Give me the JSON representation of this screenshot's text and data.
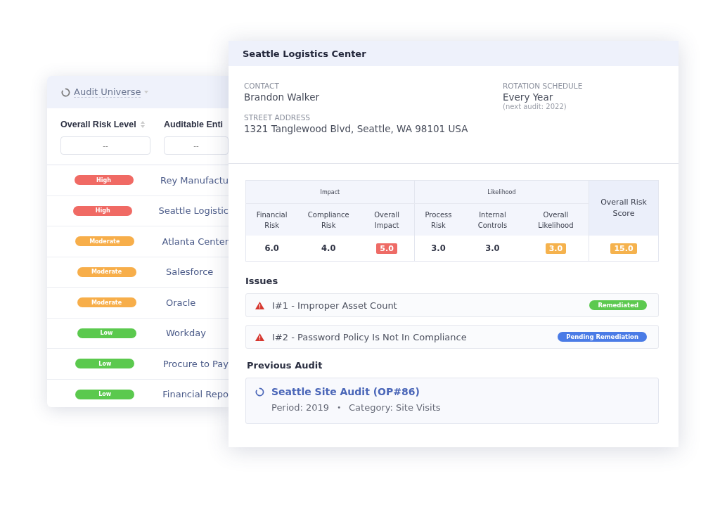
{
  "audit_universe": {
    "title": "Audit Universe",
    "columns": [
      {
        "label": "Overall Risk Level",
        "filter_placeholder": "--"
      },
      {
        "label": "Auditable Enti",
        "filter_placeholder": "--"
      }
    ],
    "rows": [
      {
        "risk": "High",
        "color": "#f06a64",
        "entity": "Rey Manufactu"
      },
      {
        "risk": "High",
        "color": "#f06a64",
        "entity": "Seattle Logistic"
      },
      {
        "risk": "Moderate",
        "color": "#f7ae4a",
        "entity": "Atlanta Center"
      },
      {
        "risk": "Moderate",
        "color": "#f7ae4a",
        "entity": "Salesforce"
      },
      {
        "risk": "Moderate",
        "color": "#f7ae4a",
        "entity": "Oracle"
      },
      {
        "risk": "Low",
        "color": "#5bc94e",
        "entity": "Workday"
      },
      {
        "risk": "Low",
        "color": "#5bc94e",
        "entity": "Procure to Pay"
      },
      {
        "risk": "Low",
        "color": "#5bc94e",
        "entity": "Financial Repo"
      }
    ]
  },
  "detail": {
    "title": "Seattle Logistics Center",
    "contact": {
      "label": "CONTACT",
      "value": "Brandon Walker"
    },
    "address": {
      "label": "STREET ADDRESS",
      "value": "1321 Tanglewood Blvd, Seattle, WA 98101 USA"
    },
    "rotation": {
      "label": "ROTATION SCHEDULE",
      "value": "Every Year",
      "note": "(next audit: 2022)"
    },
    "risk_table": {
      "groups": [
        {
          "label": "Impact",
          "columns": [
            {
              "label": "Financial Risk",
              "value": "6.0"
            },
            {
              "label": "Compliance Risk",
              "value": "4.0"
            },
            {
              "label": "Overall Impact",
              "value": "5.0",
              "color": "#ee6b66"
            }
          ]
        },
        {
          "label": "Likelihood",
          "columns": [
            {
              "label": "Process Risk",
              "value": "3.0"
            },
            {
              "label": "Internal Controls",
              "value": "3.0"
            },
            {
              "label": "Overall Likelihood",
              "value": "3.0",
              "color": "#f5b24d"
            }
          ]
        }
      ],
      "score": {
        "label": "Overall Risk Score",
        "value": "15.0",
        "color": "#f5b24d"
      }
    },
    "issues_title": "Issues",
    "issues": [
      {
        "title": "I#1 - Improper Asset Count",
        "status": "Remediated",
        "color": "#5cc94f"
      },
      {
        "title": "I#2 - Password Policy Is Not In Compliance",
        "status": "Pending Remediation",
        "color": "#4a7be6"
      }
    ],
    "previous_title": "Previous Audit",
    "previous": {
      "title": "Seattle Site Audit (OP#86)",
      "period": "Period: 2019",
      "separator": "•",
      "category": "Category: Site Visits"
    }
  }
}
